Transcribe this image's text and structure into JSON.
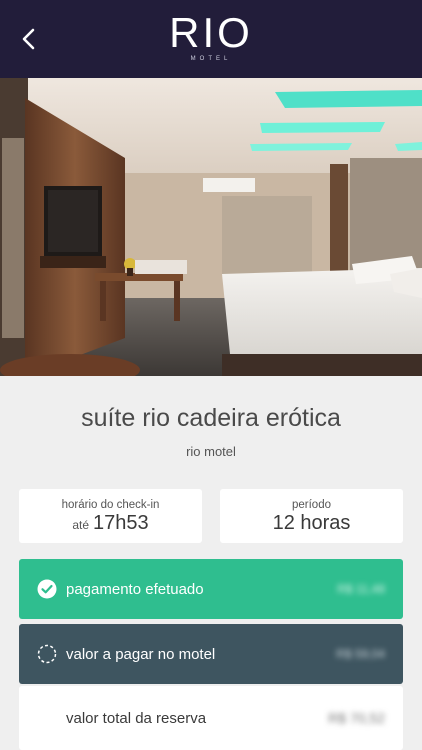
{
  "header": {
    "logo_main": "RIO",
    "logo_sub": "MOTEL"
  },
  "room": {
    "title": "suíte rio cadeira erótica",
    "motel": "rio motel"
  },
  "checkin": {
    "label": "horário do check-in",
    "prefix": "até",
    "time": "17h53"
  },
  "period": {
    "label": "período",
    "value": "12 horas"
  },
  "payment": {
    "paid_label": "pagamento efetuado",
    "paid_amount": "R$ 11,48",
    "due_label": "valor a pagar no motel",
    "due_amount": "R$ 59,04",
    "total_label": "valor total da reserva",
    "total_amount": "R$ 70,52"
  },
  "colors": {
    "header_bg": "#221d3a",
    "paid_bg": "#2fbe8f",
    "due_bg": "#3e5560"
  }
}
